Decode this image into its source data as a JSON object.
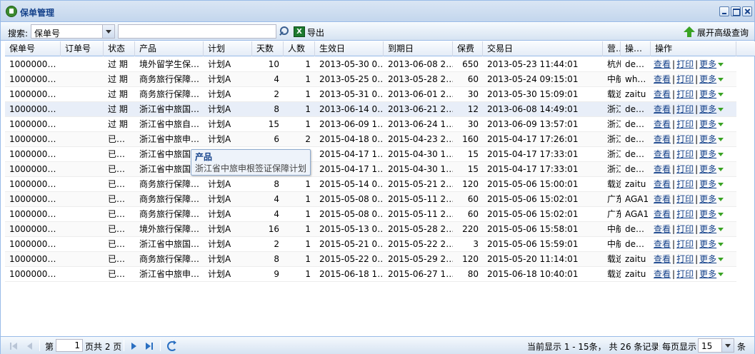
{
  "window": {
    "title": "保单管理"
  },
  "toolbar": {
    "search_label": "搜索:",
    "search_field": "保单号",
    "search_value": "",
    "export_label": "导出",
    "advanced_label": "展开高级查询"
  },
  "columns": [
    "保单号",
    "订单号",
    "状态",
    "产品",
    "计划",
    "天数",
    "人数",
    "生效日",
    "到期日",
    "保费",
    "交易日",
    "营…",
    "操…",
    "操作"
  ],
  "ops": {
    "view": "查看",
    "print": "打印",
    "more": "更多",
    "sep": "|"
  },
  "rows": [
    {
      "policy": "1000000…",
      "order": "",
      "status": "过 期",
      "product": "境外留学生保…",
      "plan": "计划A",
      "days": "10",
      "people": "1",
      "start": "2013-05-30 0…",
      "end": "2013-06-08 2…",
      "fee": "650",
      "trade": "2013-05-23 11:44:01",
      "org": "杭州",
      "op": "de…"
    },
    {
      "policy": "1000000…",
      "order": "",
      "status": "过 期",
      "product": "商务旅行保障…",
      "plan": "计划A",
      "days": "4",
      "people": "1",
      "start": "2013-05-25 0…",
      "end": "2013-05-28 2…",
      "fee": "60",
      "trade": "2013-05-24 09:15:01",
      "org": "中航",
      "op": "wh…"
    },
    {
      "policy": "1000000…",
      "order": "",
      "status": "过 期",
      "product": "商务旅行保障…",
      "plan": "计划A",
      "days": "2",
      "people": "1",
      "start": "2013-05-31 0…",
      "end": "2013-06-01 2…",
      "fee": "30",
      "trade": "2013-05-30 15:09:01",
      "org": "载途",
      "op": "zaitu"
    },
    {
      "policy": "1000000…",
      "order": "",
      "status": "过 期",
      "product": "浙江省中旅国…",
      "plan": "计划A",
      "days": "8",
      "people": "1",
      "start": "2013-06-14 0…",
      "end": "2013-06-21 2…",
      "fee": "12",
      "trade": "2013-06-08 14:49:01",
      "org": "浙江",
      "op": "de…"
    },
    {
      "policy": "1000000…",
      "order": "",
      "status": "过 期",
      "product": "浙江省中旅自…",
      "plan": "计划A",
      "days": "15",
      "people": "1",
      "start": "2013-06-09 1…",
      "end": "2013-06-24 1…",
      "fee": "30",
      "trade": "2013-06-09 13:57:01",
      "org": "浙江",
      "op": "de…"
    },
    {
      "policy": "1000000…",
      "order": "",
      "status": "已…",
      "product": "浙江省中旅申…",
      "plan": "计划A",
      "days": "6",
      "people": "2",
      "start": "2015-04-18 0…",
      "end": "2015-04-23 2…",
      "fee": "160",
      "trade": "2015-04-17 17:26:01",
      "org": "浙江",
      "op": "de…"
    },
    {
      "policy": "1000000…",
      "order": "",
      "status": "已…",
      "product": "浙江省中旅国",
      "plan": "",
      "days": "",
      "people": "",
      "start": "2015-04-17 1…",
      "end": "2015-04-30 1…",
      "fee": "15",
      "trade": "2015-04-17 17:33:01",
      "org": "浙江",
      "op": "de…"
    },
    {
      "policy": "1000000…",
      "order": "",
      "status": "已…",
      "product": "浙江省中旅国",
      "plan": "",
      "days": "",
      "people": "",
      "start": "2015-04-17 1…",
      "end": "2015-04-30 1…",
      "fee": "15",
      "trade": "2015-04-17 17:33:01",
      "org": "浙江",
      "op": "de…"
    },
    {
      "policy": "1000000…",
      "order": "",
      "status": "已…",
      "product": "商务旅行保障…",
      "plan": "计划A",
      "days": "8",
      "people": "1",
      "start": "2015-05-14 0…",
      "end": "2015-05-21 2…",
      "fee": "120",
      "trade": "2015-05-06 15:00:01",
      "org": "载途",
      "op": "zaitu"
    },
    {
      "policy": "1000000…",
      "order": "",
      "status": "已…",
      "product": "商务旅行保障…",
      "plan": "计划A",
      "days": "4",
      "people": "1",
      "start": "2015-05-08 0…",
      "end": "2015-05-11 2…",
      "fee": "60",
      "trade": "2015-05-06 15:02:01",
      "org": "广东",
      "op": "AGA1"
    },
    {
      "policy": "1000000…",
      "order": "",
      "status": "已…",
      "product": "商务旅行保障…",
      "plan": "计划A",
      "days": "4",
      "people": "1",
      "start": "2015-05-08 0…",
      "end": "2015-05-11 2…",
      "fee": "60",
      "trade": "2015-05-06 15:02:01",
      "org": "广东",
      "op": "AGA1"
    },
    {
      "policy": "1000000…",
      "order": "",
      "status": "已…",
      "product": "境外旅行保障…",
      "plan": "计划A",
      "days": "16",
      "people": "1",
      "start": "2015-05-13 0…",
      "end": "2015-05-28 2…",
      "fee": "220",
      "trade": "2015-05-06 15:58:01",
      "org": "中航",
      "op": "de…"
    },
    {
      "policy": "1000000…",
      "order": "",
      "status": "已…",
      "product": "浙江省中旅国…",
      "plan": "计划A",
      "days": "2",
      "people": "1",
      "start": "2015-05-21 0…",
      "end": "2015-05-22 2…",
      "fee": "3",
      "trade": "2015-05-06 15:59:01",
      "org": "中航",
      "op": "de…"
    },
    {
      "policy": "1000000…",
      "order": "",
      "status": "已…",
      "product": "商务旅行保障…",
      "plan": "计划A",
      "days": "8",
      "people": "1",
      "start": "2015-05-22 0…",
      "end": "2015-05-29 2…",
      "fee": "120",
      "trade": "2015-05-20 11:14:01",
      "org": "载途",
      "op": "zaitu"
    },
    {
      "policy": "1000000…",
      "order": "",
      "status": "已…",
      "product": "浙江省中旅申…",
      "plan": "计划A",
      "days": "9",
      "people": "1",
      "start": "2015-06-18 1…",
      "end": "2015-06-27 1…",
      "fee": "80",
      "trade": "2015-06-18 10:40:01",
      "org": "载途",
      "op": "zaitu"
    }
  ],
  "tooltip": {
    "title": "产品",
    "body": "浙江省中旅申根签证保障计划"
  },
  "pager": {
    "page_prefix": "第",
    "current_page": "1",
    "page_suffix": "页共 2 页",
    "summary": "当前显示 1 - 15条， 共 26 条记录",
    "per_page_label": "每页显示",
    "per_page_value": "15",
    "per_page_unit": "条"
  }
}
